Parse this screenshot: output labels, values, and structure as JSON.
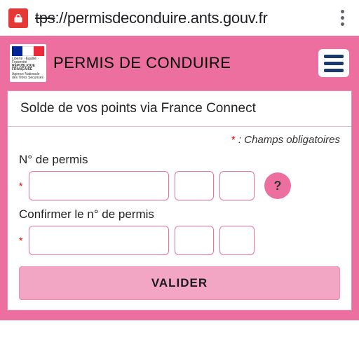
{
  "browser": {
    "url_proto_struck": "tps",
    "url_rest": "://permisdeconduire.ants.gouv.fr"
  },
  "header": {
    "title": "PERMIS DE CONDUIRE",
    "logo_line1": "Liberté · Égalité · Fraternité",
    "logo_line2": "RÉPUBLIQUE FRANÇAISE",
    "logo_line3": "Agence Nationale des Titres Sécurisés"
  },
  "form": {
    "card_title": "Solde de vos points via France Connect",
    "mandatory_note": ": Champs obligatoires",
    "asterisk": "*",
    "permit_label": "N° de permis",
    "confirm_label": "Confirmer le n° de permis",
    "help_label": "?",
    "submit_label": "VALIDER"
  }
}
